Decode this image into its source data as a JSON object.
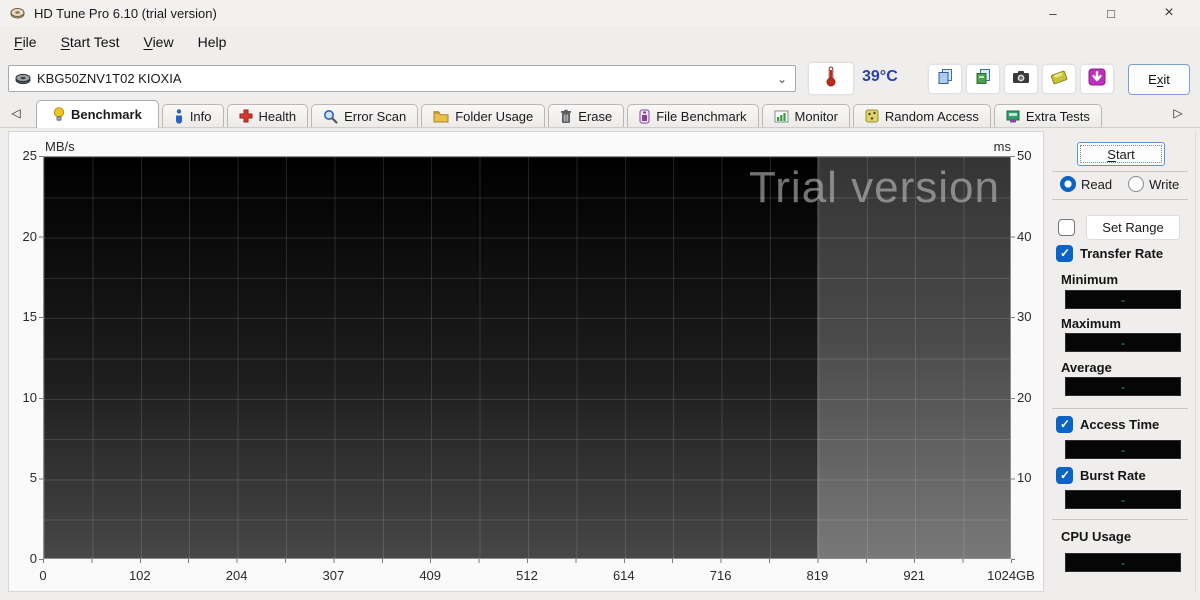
{
  "window": {
    "title": "HD Tune Pro 6.10 (trial version)"
  },
  "icons": {
    "minimize": "–",
    "maximize": "□",
    "close": "×",
    "chevron_down": "⌄",
    "tab_prev": "◁",
    "tab_next": "▷"
  },
  "menu": {
    "items": [
      {
        "label": "File",
        "accel": 0
      },
      {
        "label": "Start Test",
        "accel": 0
      },
      {
        "label": "View",
        "accel": 0
      },
      {
        "label": "Help",
        "accel": -1
      }
    ]
  },
  "toolbar": {
    "drive_selector": {
      "value": "KBG50ZNV1T02 KIOXIA"
    },
    "temperature": "39°C",
    "exit_button": {
      "label": "Exit",
      "accel": 1
    }
  },
  "tabs": [
    {
      "id": "benchmark",
      "label": "Benchmark",
      "active": true
    },
    {
      "id": "info",
      "label": "Info",
      "active": false
    },
    {
      "id": "health",
      "label": "Health",
      "active": false
    },
    {
      "id": "error-scan",
      "label": "Error Scan",
      "active": false
    },
    {
      "id": "folder-usage",
      "label": "Folder Usage",
      "active": false
    },
    {
      "id": "erase",
      "label": "Erase",
      "active": false
    },
    {
      "id": "file-benchmark",
      "label": "File Benchmark",
      "active": false
    },
    {
      "id": "monitor",
      "label": "Monitor",
      "active": false
    },
    {
      "id": "random-access",
      "label": "Random Access",
      "active": false
    },
    {
      "id": "extra-tests",
      "label": "Extra Tests",
      "active": false
    }
  ],
  "chart_data": {
    "type": "line",
    "title": "",
    "watermark": "Trial version",
    "x_axis": {
      "ticks": [
        "0",
        "102",
        "204",
        "307",
        "409",
        "512",
        "614",
        "716",
        "819",
        "921",
        "1024GB"
      ],
      "range": [
        0,
        1024
      ],
      "unit": "GB"
    },
    "y_left": {
      "label": "MB/s",
      "ticks": [
        "25",
        "20",
        "15",
        "10",
        "5",
        "0"
      ],
      "range": [
        0,
        25
      ]
    },
    "y_right": {
      "label": "ms",
      "ticks": [
        "50",
        "40",
        "30",
        "20",
        "10"
      ],
      "range": [
        0,
        50
      ]
    },
    "series": [
      {
        "name": "Transfer Rate",
        "values": []
      },
      {
        "name": "Access Time",
        "values": []
      }
    ],
    "grid": true,
    "plot_background_split_at_gb": 819,
    "colors": {
      "plot_dark_top": "#000000",
      "plot_dark_bottom": "#474747",
      "plot_light_top": "#343434",
      "plot_light_bottom": "#787878"
    }
  },
  "panel": {
    "start_button": {
      "label": "Start",
      "accel": 0
    },
    "mode": {
      "read_label": "Read",
      "write_label": "Write",
      "selected": "Read"
    },
    "set_range": {
      "label": "Set Range",
      "checked": false
    },
    "transfer_rate": {
      "label": "Transfer Rate",
      "checked": true,
      "minimum_label": "Minimum",
      "minimum": "-",
      "maximum_label": "Maximum",
      "maximum": "-",
      "average_label": "Average",
      "average": "-"
    },
    "access_time": {
      "label": "Access Time",
      "checked": true,
      "value": "-"
    },
    "burst_rate": {
      "label": "Burst Rate",
      "checked": true,
      "value": "-"
    },
    "cpu_usage": {
      "label": "CPU Usage",
      "value": "-"
    }
  },
  "colors": {
    "accent_blue": "#0b63c5",
    "temperature_blue": "#2b3faf",
    "value_teal": "#2fa8a8"
  }
}
